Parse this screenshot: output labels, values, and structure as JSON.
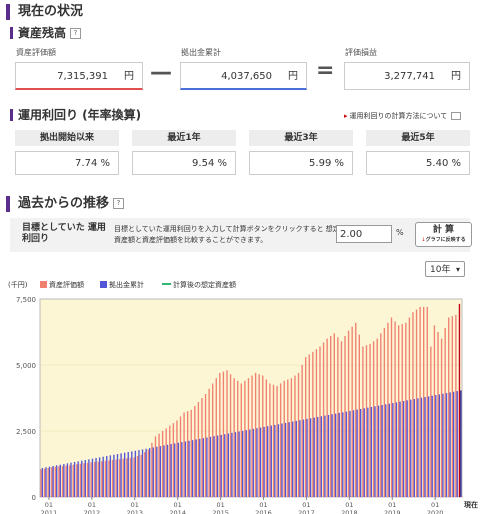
{
  "section_title": "現在の状況",
  "balance": {
    "title": "資産残高",
    "labels": [
      "資産評価額",
      "拠出金累計",
      "評価損益"
    ],
    "values": [
      "7,315,391",
      "4,037,650",
      "3,277,741"
    ],
    "unit": "円",
    "minus": "—",
    "equals": "="
  },
  "performance": {
    "title": "運用利回り (年率換算)",
    "link": "運用利回りの計算方法について",
    "headers": [
      "拠出開始以来",
      "最近1年",
      "最近3年",
      "最近5年"
    ],
    "values": [
      "7.74 %",
      "9.54 %",
      "5.99 %",
      "5.40 %"
    ]
  },
  "history": {
    "title": "過去からの推移",
    "calc_label": "目標としていた 運用利回り",
    "calc_desc": "目標としていた運用利回りを入力して計算ボタンをクリックすると 想定資産額と資産評価額を比較することができます。",
    "rate_value": "2.00",
    "pct": "%",
    "button_label": "計 算",
    "button_sub_arrow": "↓",
    "button_sub": "グラフに反映する",
    "period_option": "10年",
    "legend": [
      "資産評価額",
      "拠出金累計",
      "計算後の想定資産額"
    ]
  },
  "colors": {
    "accent": "#5a2d8a",
    "valuation": "#f08070",
    "contribution": "#5555d8",
    "projected": "#2eb872",
    "chart_bg": "#fdf6d4",
    "current": "#c0001a"
  },
  "icons": {
    "help": "question-icon",
    "link": "window-icon",
    "dropdown": "chevron-down-icon"
  },
  "chart_data": {
    "type": "bar",
    "unit_label": "(千円)",
    "yticks": [
      "7,500",
      "5,000",
      "2,500",
      "0"
    ],
    "ylim": [
      0,
      7500
    ],
    "xlabels": [
      "01\n2011",
      "01\n2012",
      "01\n2013",
      "01\n2014",
      "01\n2015",
      "01\n2016",
      "01\n2017",
      "01\n2018",
      "01\n2019",
      "01\n2020"
    ],
    "current_label": "現在",
    "start": "2010-10",
    "months": 118,
    "contribution_start": 1100,
    "contribution_end": 4037.65,
    "valuation_anchors": [
      [
        0,
        1050
      ],
      [
        4,
        1150
      ],
      [
        8,
        1200
      ],
      [
        12,
        1280
      ],
      [
        20,
        1400
      ],
      [
        26,
        1500
      ],
      [
        28,
        1600
      ],
      [
        30,
        1800
      ],
      [
        32,
        2300
      ],
      [
        34,
        2500
      ],
      [
        36,
        2700
      ],
      [
        38,
        2900
      ],
      [
        40,
        3200
      ],
      [
        42,
        3300
      ],
      [
        44,
        3600
      ],
      [
        46,
        3900
      ],
      [
        48,
        4300
      ],
      [
        50,
        4700
      ],
      [
        52,
        4800
      ],
      [
        54,
        4500
      ],
      [
        56,
        4300
      ],
      [
        58,
        4500
      ],
      [
        60,
        4700
      ],
      [
        62,
        4600
      ],
      [
        64,
        4300
      ],
      [
        66,
        4200
      ],
      [
        68,
        4400
      ],
      [
        70,
        4500
      ],
      [
        72,
        4700
      ],
      [
        74,
        5300
      ],
      [
        76,
        5500
      ],
      [
        78,
        5700
      ],
      [
        80,
        6000
      ],
      [
        82,
        6200
      ],
      [
        84,
        5900
      ],
      [
        86,
        6300
      ],
      [
        88,
        6600
      ],
      [
        90,
        5700
      ],
      [
        92,
        5800
      ],
      [
        94,
        6000
      ],
      [
        96,
        6400
      ],
      [
        98,
        6800
      ],
      [
        100,
        6500
      ],
      [
        102,
        6600
      ],
      [
        104,
        7000
      ],
      [
        106,
        7200
      ],
      [
        108,
        7200
      ],
      [
        109,
        5700
      ],
      [
        110,
        6500
      ],
      [
        112,
        6000
      ],
      [
        114,
        6800
      ],
      [
        116,
        6900
      ],
      [
        117,
        7315.391
      ]
    ],
    "series": [
      {
        "name": "資産評価額",
        "color": "#f08070"
      },
      {
        "name": "拠出金累計",
        "color": "#5555d8"
      },
      {
        "name": "計算後の想定資産額",
        "color": "#2eb872"
      }
    ]
  }
}
